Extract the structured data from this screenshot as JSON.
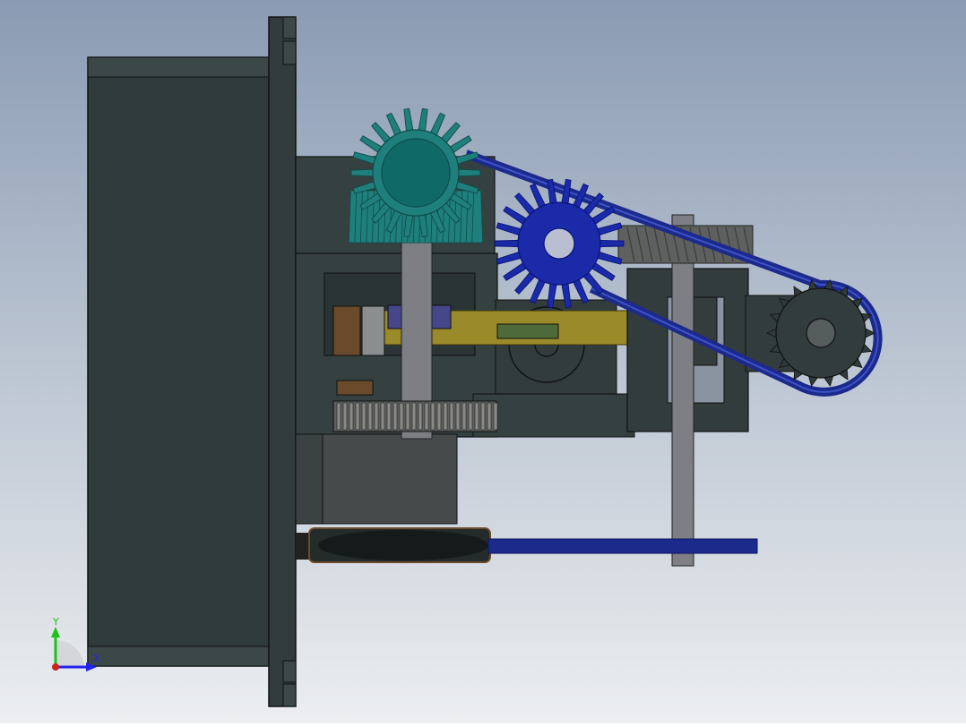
{
  "viewport": {
    "background_top": "#8a9bb3",
    "background_bottom": "#eceef0"
  },
  "colors": {
    "body_dark": "#2f3a3a",
    "body_edge": "#1b2222",
    "body_face": "#3a4444",
    "teal_gear": "#1f7f7c",
    "teal_gear_dark": "#0e4c4a",
    "blue_gear": "#1a2aa8",
    "blue_gear_dark": "#0a137a",
    "belt_blue": "#1c2a8c",
    "shaft_grey": "#7d7f84",
    "rack_grey": "#5d605e",
    "brass": "#9a8a2a",
    "copper": "#6a4a2a",
    "green_tab": "#4e6a3a"
  },
  "icons": {
    "triad": "view-orientation-triad-icon"
  },
  "triad": {
    "y_label": "Y",
    "x_label": "X",
    "y_color": "#1cc21c",
    "x_color": "#2222ee",
    "origin_color": "#cc2222"
  }
}
